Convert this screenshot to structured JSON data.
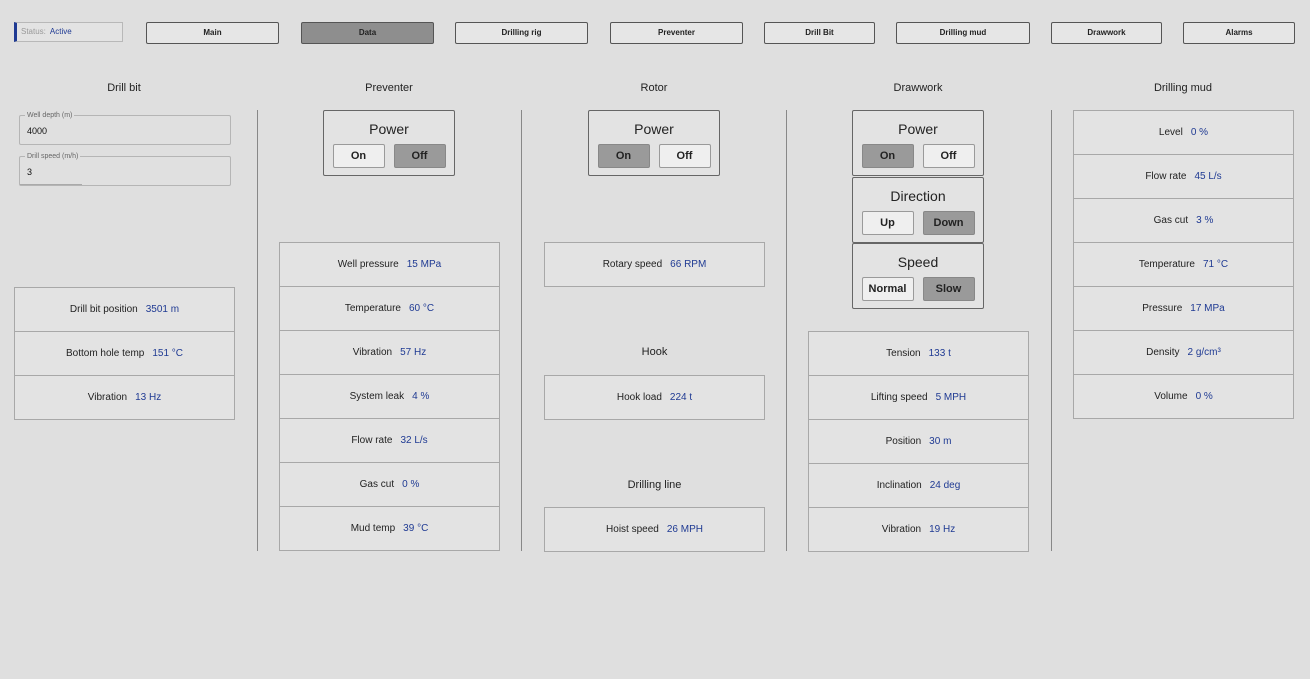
{
  "status": {
    "key": "Status:",
    "value": "Active"
  },
  "nav": {
    "main": "Main",
    "data": "Data",
    "drilling_rig": "Drilling rig",
    "preventer": "Preventer",
    "drill_bit": "Drill Bit",
    "drilling_mud": "Drilling mud",
    "drawwork": "Drawwork",
    "alarms": "Alarms"
  },
  "drill_bit": {
    "title": "Drill bit",
    "well_depth": {
      "label": "Well depth (m)",
      "value": "4000"
    },
    "drill_speed": {
      "label": "Drill speed (m/h)",
      "value": "3"
    },
    "rows": [
      {
        "label": "Drill bit position",
        "value": "3501 m"
      },
      {
        "label": "Bottom hole temp",
        "value": "151 °C"
      },
      {
        "label": "Vibration",
        "value": "13 Hz"
      }
    ]
  },
  "preventer": {
    "title": "Preventer",
    "power": {
      "title": "Power",
      "on": "On",
      "off": "Off",
      "selected": "off"
    },
    "rows": [
      {
        "label": "Well pressure",
        "value": "15 MPa"
      },
      {
        "label": "Temperature",
        "value": "60 °C"
      },
      {
        "label": "Vibration",
        "value": "57 Hz"
      },
      {
        "label": "System leak",
        "value": "4 %"
      },
      {
        "label": "Flow rate",
        "value": "32 L/s"
      },
      {
        "label": "Gas cut",
        "value": "0 %"
      },
      {
        "label": "Mud temp",
        "value": "39 °C"
      }
    ]
  },
  "rotor": {
    "title": "Rotor",
    "power": {
      "title": "Power",
      "on": "On",
      "off": "Off",
      "selected": "on"
    },
    "rotary": {
      "label": "Rotary speed",
      "value": "66 RPM"
    },
    "hook_title": "Hook",
    "hook": {
      "label": "Hook load",
      "value": "224 t"
    },
    "line_title": "Drilling line",
    "line": {
      "label": "Hoist speed",
      "value": "26 MPH"
    }
  },
  "drawwork": {
    "title": "Drawwork",
    "power": {
      "title": "Power",
      "on": "On",
      "off": "Off",
      "selected": "on"
    },
    "direction": {
      "title": "Direction",
      "up": "Up",
      "down": "Down",
      "selected": "down"
    },
    "speed": {
      "title": "Speed",
      "normal": "Normal",
      "slow": "Slow",
      "selected": "slow"
    },
    "rows": [
      {
        "label": "Tension",
        "value": "133 t"
      },
      {
        "label": "Lifting speed",
        "value": "5 MPH"
      },
      {
        "label": "Position",
        "value": "30 m"
      },
      {
        "label": "Inclination",
        "value": "24 deg"
      },
      {
        "label": "Vibration",
        "value": "19 Hz"
      }
    ]
  },
  "drilling_mud": {
    "title": "Drilling mud",
    "rows": [
      {
        "label": "Level",
        "value": "0 %"
      },
      {
        "label": "Flow rate",
        "value": "45 L/s"
      },
      {
        "label": "Gas cut",
        "value": "3 %"
      },
      {
        "label": "Temperature",
        "value": "71 °C"
      },
      {
        "label": "Pressure",
        "value": "17 MPa"
      },
      {
        "label": "Density",
        "value": "2 g/cm³"
      },
      {
        "label": "Volume",
        "value": "0 %"
      }
    ]
  }
}
